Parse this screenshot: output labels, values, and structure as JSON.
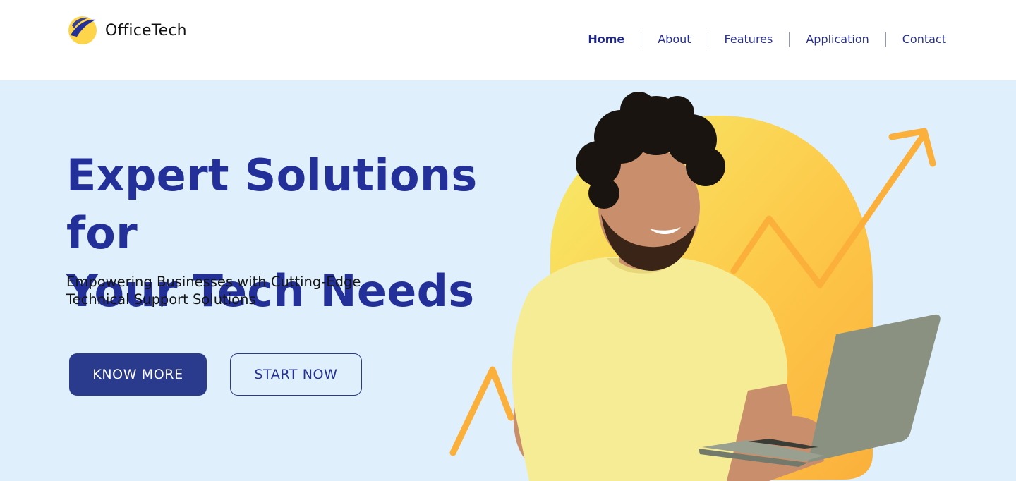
{
  "brand": {
    "name": "OfficeTech",
    "logo_icon": "swoosh-circle-icon"
  },
  "nav": {
    "items": [
      {
        "label": "Home",
        "active": true
      },
      {
        "label": "About",
        "active": false
      },
      {
        "label": "Features",
        "active": false
      },
      {
        "label": "Application",
        "active": false
      },
      {
        "label": "Contact",
        "active": false
      }
    ]
  },
  "hero": {
    "headline_line1": "Expert Solutions for",
    "headline_line2": "Your Tech Needs",
    "subhead_line1": "Empowering Businesses with Cutting-Edge",
    "subhead_line2": "Technical Support Solutions",
    "primary_button": "KNOW MORE",
    "secondary_button": "START NOW"
  },
  "colors": {
    "brand_blue": "#24309a",
    "button_blue": "#2a3a8d",
    "hero_background": "#dff0fc",
    "accent_yellow": "#fdd44a",
    "accent_orange": "#fbb03b"
  }
}
